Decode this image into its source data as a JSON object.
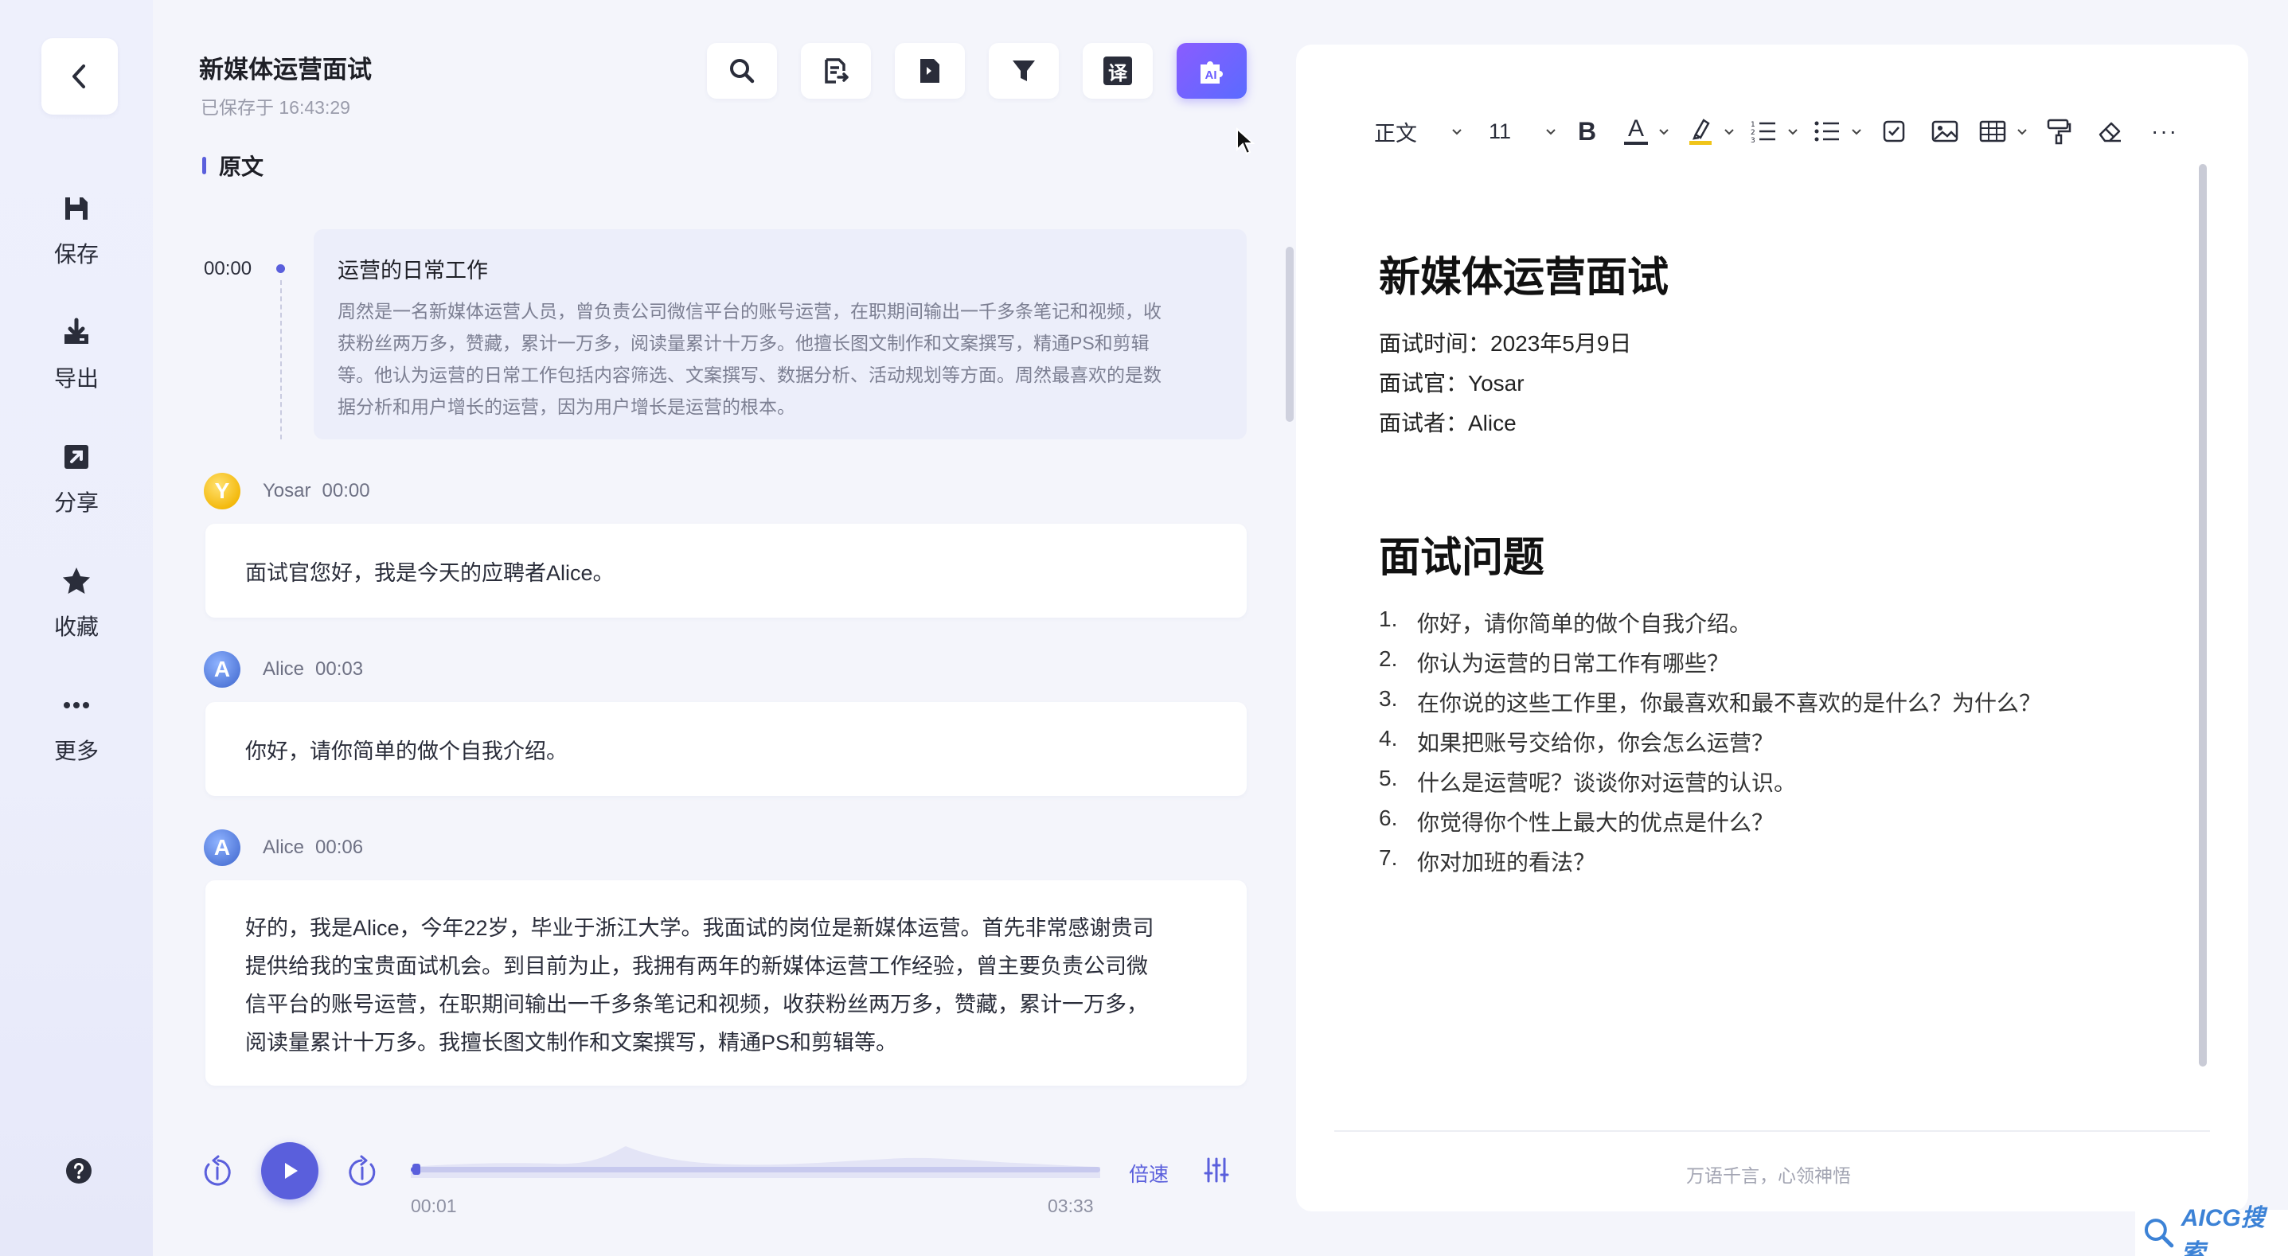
{
  "sidebar": {
    "back_icon": "chevron-left-icon",
    "items": [
      {
        "label": "保存",
        "icon": "save-icon"
      },
      {
        "label": "导出",
        "icon": "download-icon"
      },
      {
        "label": "分享",
        "icon": "share-icon"
      },
      {
        "label": "收藏",
        "icon": "star-icon"
      },
      {
        "label": "更多",
        "icon": "more-icon"
      }
    ],
    "help_icon": "help-icon"
  },
  "header": {
    "title": "新媒体运营面试",
    "saved": "已保存于 16:43:29",
    "tools": [
      "search-icon",
      "summary-icon",
      "export-doc-icon",
      "filter-icon",
      "translate-icon",
      "ai-icon"
    ],
    "translate_label": "译",
    "ai_label": "AI"
  },
  "transcript": {
    "section": "原文",
    "summary": {
      "time": "00:00",
      "title": "运营的日常工作",
      "lines": [
        "周然是一名新媒体运营人员，曾负责公司微信平台的账号运营，在职期间输出一千多条笔记和视频，收",
        "获粉丝两万多，赞藏，累计一万多，阅读量累计十万多。他擅长图文制作和文案撰写，精通PS和剪辑",
        "等。他认为运营的日常工作包括内容筛选、文案撰写、数据分析、活动规划等方面。周然最喜欢的是数",
        "据分析和用户增长的运营，因为用户增长是运营的根本。"
      ]
    },
    "messages": [
      {
        "avatar": "Y",
        "speaker": "Yosar",
        "time": "00:00",
        "lines": [
          "面试官您好，我是今天的应聘者Alice。"
        ]
      },
      {
        "avatar": "A",
        "speaker": "Alice",
        "time": "00:03",
        "lines": [
          "你好，请你简单的做个自我介绍。"
        ]
      },
      {
        "avatar": "A",
        "speaker": "Alice",
        "time": "00:06",
        "lines": [
          "好的，我是Alice，今年22岁，毕业于浙江大学。我面试的岗位是新媒体运营。首先非常感谢贵司",
          "提供给我的宝贵面试机会。到目前为止，我拥有两年的新媒体运营工作经验，曾主要负责公司微",
          "信平台的账号运营，在职期间输出一千多条笔记和视频，收获粉丝两万多，赞藏，累计一万多，",
          "阅读量累计十万多。我擅长图文制作和文案撰写，精通PS和剪辑等。"
        ]
      }
    ]
  },
  "player": {
    "current": "00:01",
    "total": "03:33",
    "progress": 0.005,
    "speed_label": "倍速"
  },
  "editor": {
    "toolbar": {
      "style": "正文",
      "size": "11",
      "bold": "B",
      "font_color": "A",
      "more": "···"
    },
    "doc": {
      "h1": "新媒体运营面试",
      "meta": [
        "面试时间：2023年5月9日",
        "面试官：Yosar",
        "面试者：Alice"
      ],
      "h2": "面试问题",
      "questions": [
        "你好，请你简单的做个自我介绍。",
        "你认为运营的日常工作有哪些？",
        "在你说的这些工作里，你最喜欢和最不喜欢的是什么？为什么？",
        "如果把账号交给你，你会怎么运营？",
        "什么是运营呢？谈谈你对运营的认识。",
        "你觉得你个性上最大的优点是什么？",
        "你对加班的看法？"
      ],
      "question_numbers": [
        "1.",
        "2.",
        "3.",
        "4.",
        "5.",
        "6.",
        "7."
      ]
    },
    "footer": "万语千言，心领神悟"
  },
  "watermark": "AICG搜索",
  "colors": {
    "accent": "#5a5fdc",
    "ai_gradient_start": "#8a5cff",
    "ai_gradient_end": "#5a6bff"
  }
}
